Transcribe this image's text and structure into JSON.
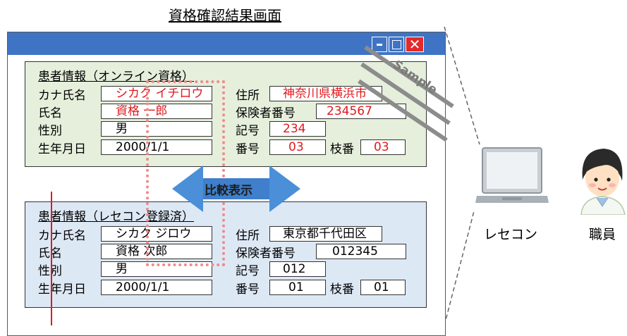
{
  "screen_title": "資格確認結果画面",
  "window": {
    "minimize_icon": "minimize-icon",
    "maximize_icon": "maximize-icon",
    "close_icon": "close-icon",
    "close_glyph": "✕"
  },
  "online": {
    "title": "患者情報（オンライン資格）",
    "kana_label": "カナ氏名",
    "kana_value": "シカク イチロウ",
    "name_label": "氏名",
    "name_value": "資格 一郎",
    "gender_label": "性別",
    "gender_value": "男",
    "dob_label": "生年月日",
    "dob_value": "2000/1/1",
    "address_label": "住所",
    "address_value": "神奈川県横浜市",
    "insurer_label": "保険者番号",
    "insurer_value": "234567",
    "symbol_label": "記号",
    "symbol_value": "234",
    "number_label": "番号",
    "number_value": "03",
    "branch_label": "枝番",
    "branch_value": "03"
  },
  "rececon": {
    "title": "患者情報（レセコン登録済）",
    "kana_label": "カナ氏名",
    "kana_value": "シカク ジロウ",
    "name_label": "氏名",
    "name_value": "資格 次郎",
    "gender_label": "性別",
    "gender_value": "男",
    "dob_label": "生年月日",
    "dob_value": "2000/1/1",
    "address_label": "住所",
    "address_value": "東京都千代田区",
    "insurer_label": "保険者番号",
    "insurer_value": "012345",
    "symbol_label": "記号",
    "symbol_value": "012",
    "number_label": "番号",
    "number_value": "01",
    "branch_label": "枝番",
    "branch_value": "01"
  },
  "compare_label": "比較表示",
  "sample_label": "Sample",
  "laptop_label": "レセコン",
  "staff_label": "職員",
  "colors": {
    "titlebar": "#3f74c5",
    "highlight_red": "#e0191d",
    "online_bg": "#e5efdc",
    "rececon_bg": "#dde8f5"
  }
}
